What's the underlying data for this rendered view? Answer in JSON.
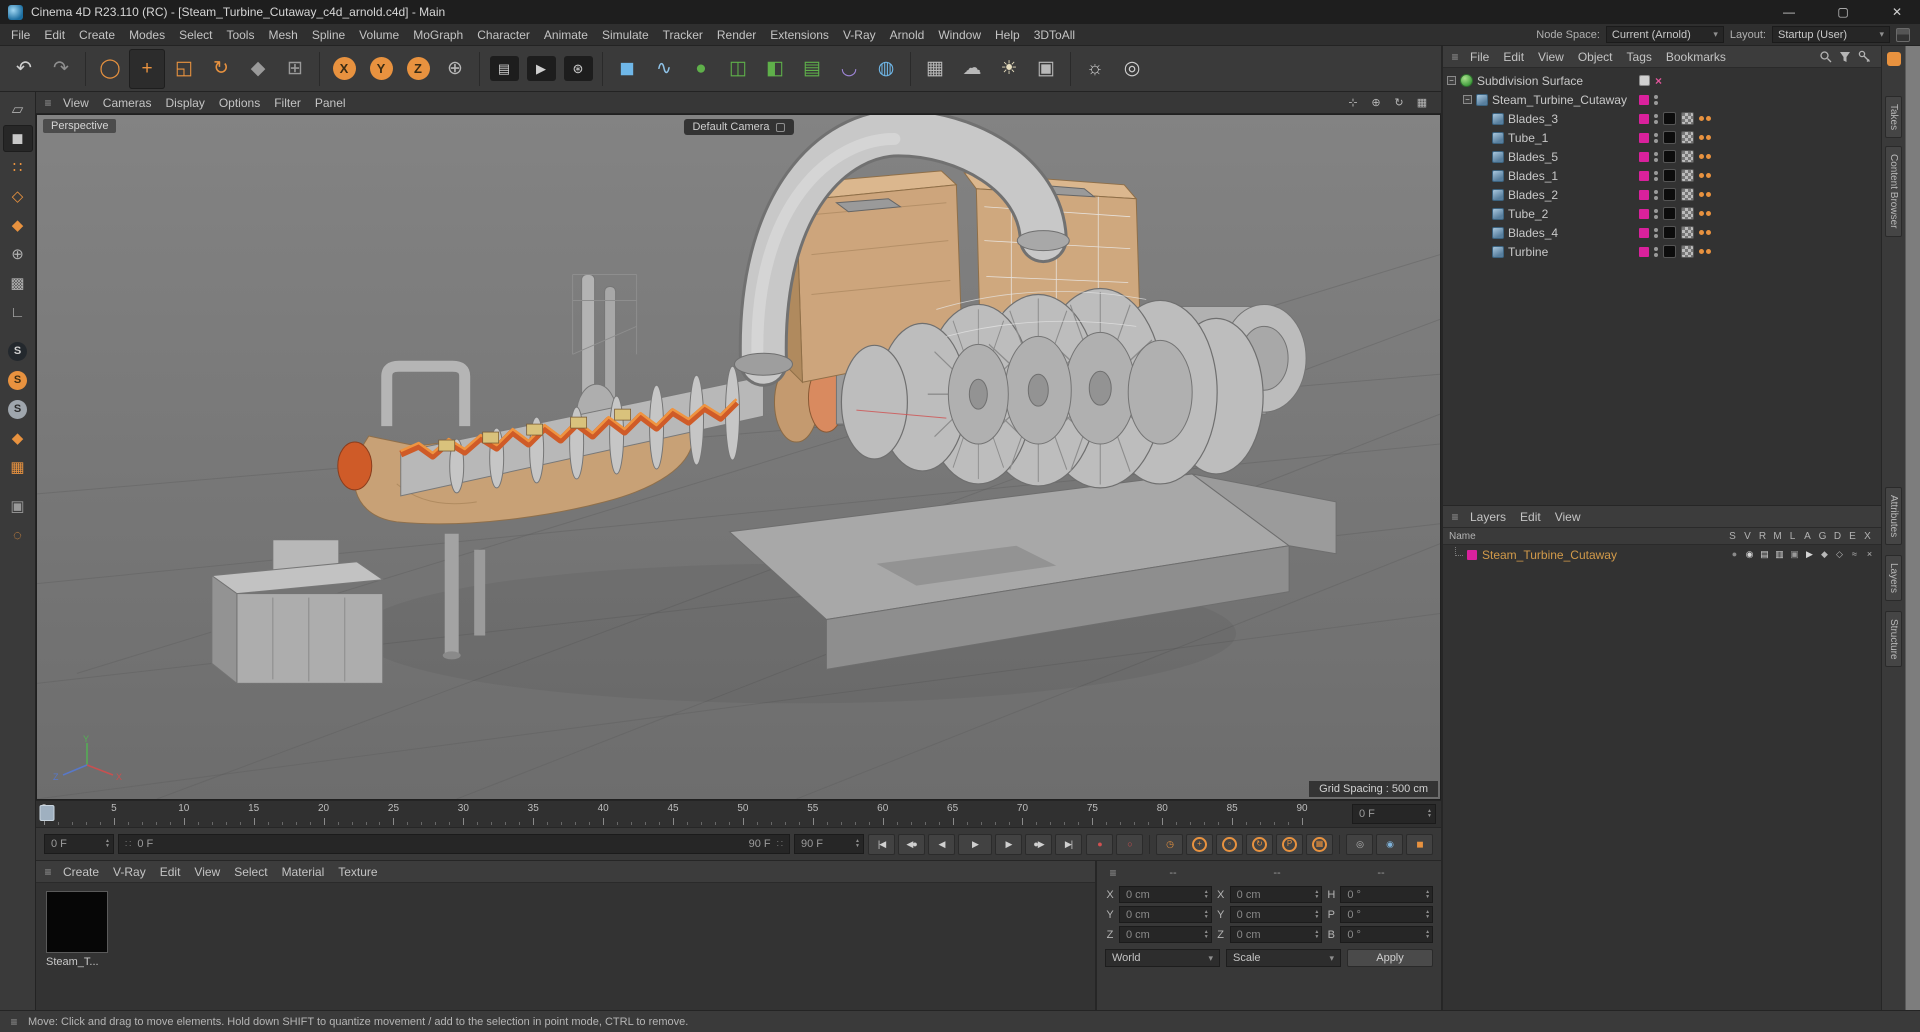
{
  "window": {
    "title": "Cinema 4D R23.110 (RC) - [Steam_Turbine_Cutaway_c4d_arnold.c4d] - Main",
    "minimize_glyph": "—",
    "maximize_glyph": "▢",
    "close_glyph": "✕"
  },
  "icons": {
    "hamburger": "≡",
    "dropdown_arrow": "▾",
    "spinner_up": "▲",
    "spinner_down": "▼",
    "slider_grip": "∷",
    "expander_open": "−"
  },
  "menubar": {
    "items": [
      "File",
      "Edit",
      "Create",
      "Modes",
      "Select",
      "Tools",
      "Mesh",
      "Spline",
      "Volume",
      "MoGraph",
      "Character",
      "Animate",
      "Simulate",
      "Tracker",
      "Render",
      "Extensions",
      "V-Ray",
      "Arnold",
      "Window",
      "Help",
      "3DToAll"
    ],
    "node_space_label": "Node Space:",
    "node_space_value": "Current (Arnold)",
    "layout_label": "Layout:",
    "layout_value": "Startup (User)"
  },
  "toolbar": {
    "buttons": [
      {
        "name": "undo-button",
        "glyph": "↶",
        "color": "#cfcfcf"
      },
      {
        "name": "redo-button",
        "glyph": "↷",
        "color": "#8f8f8f"
      },
      {
        "sep": true
      },
      {
        "name": "live-selection-tool",
        "glyph": "◯",
        "color": "#e8923f"
      },
      {
        "name": "move-tool",
        "glyph": "+",
        "color": "#e8923f",
        "selected": true
      },
      {
        "name": "scale-tool",
        "glyph": "◱",
        "color": "#e8923f"
      },
      {
        "name": "rotate-tool",
        "glyph": "↻",
        "color": "#e8923f"
      },
      {
        "name": "recent-tools-button",
        "glyph": "◆",
        "color": "#9a9a9a"
      },
      {
        "name": "omni-move-button",
        "glyph": "⊞",
        "color": "#9a9a9a"
      },
      {
        "sep": true
      },
      {
        "name": "x-axis-lock-button",
        "glyph": "X",
        "color": "#3a2c14",
        "bg": "#e8923f",
        "round": true
      },
      {
        "name": "y-axis-lock-button",
        "glyph": "Y",
        "color": "#3a2c14",
        "bg": "#e8923f",
        "round": true
      },
      {
        "name": "z-axis-lock-button",
        "glyph": "Z",
        "color": "#3a2c14",
        "bg": "#e8923f",
        "round": true
      },
      {
        "name": "coordinate-system-button",
        "glyph": "⊕",
        "color": "#b8b8b8"
      },
      {
        "sep": true
      },
      {
        "name": "render-view-button",
        "glyph": "▤",
        "color": "#cfcfcf",
        "bg": "#1d1d1d",
        "sq": true
      },
      {
        "name": "render-picture-viewer-button",
        "glyph": "▶",
        "color": "#cfcfcf",
        "bg": "#1d1d1d",
        "sq": true
      },
      {
        "name": "render-settings-button",
        "glyph": "⊛",
        "color": "#cfcfcf",
        "bg": "#1d1d1d",
        "sq": true
      },
      {
        "sep": true
      },
      {
        "name": "add-cube-button",
        "glyph": "◼",
        "color": "#6fb7e8"
      },
      {
        "name": "pen-tool-button",
        "glyph": "∿",
        "color": "#8fc3e8"
      },
      {
        "name": "subdivision-surface-button",
        "glyph": "●",
        "color": "#5fb04a"
      },
      {
        "name": "array-button",
        "glyph": "◫",
        "color": "#5fb04a"
      },
      {
        "name": "boolean-button",
        "glyph": "◧",
        "color": "#5fb04a"
      },
      {
        "name": "fields-button",
        "glyph": "▤",
        "color": "#5fb04a"
      },
      {
        "name": "deformer-button",
        "glyph": "◡",
        "color": "#9f86d8"
      },
      {
        "name": "volume-button",
        "glyph": "◍",
        "color": "#6fb7e8"
      },
      {
        "sep": true
      },
      {
        "name": "floor-button",
        "glyph": "▦",
        "color": "#b8b8b8"
      },
      {
        "name": "sky-button",
        "glyph": "☁",
        "color": "#b8b8b8"
      },
      {
        "name": "light-button",
        "glyph": "☀",
        "color": "#e8dfc0"
      },
      {
        "name": "camera-button",
        "glyph": "▣",
        "color": "#b8b8b8"
      },
      {
        "sep": true
      },
      {
        "name": "physical-sky-button",
        "glyph": "☼",
        "color": "#cfcfcf"
      },
      {
        "name": "environment-button",
        "glyph": "◎",
        "color": "#cfcfcf"
      }
    ]
  },
  "palette": {
    "buttons": [
      {
        "name": "make-editable-button",
        "glyph": "▱",
        "color": "#b0b0b0"
      },
      {
        "name": "model-mode-button",
        "glyph": "◼",
        "color": "#c8c8c8",
        "selected": true
      },
      {
        "name": "points-mode-button",
        "glyph": "∷",
        "color": "#e8923f"
      },
      {
        "name": "edges-mode-button",
        "glyph": "◇",
        "color": "#e8923f"
      },
      {
        "name": "polygons-mode-button",
        "glyph": "◆",
        "color": "#e8923f"
      },
      {
        "name": "axis-mode-button",
        "glyph": "⊕",
        "color": "#b0b0b0"
      },
      {
        "name": "texture-mode-button",
        "glyph": "▩",
        "color": "#b0b0b0"
      },
      {
        "name": "workplane-mode-button",
        "glyph": "∟",
        "color": "#b0b0b0"
      },
      {
        "sep": true
      },
      {
        "name": "snap-off-button",
        "glyph": "S",
        "color": "#cfcfcf",
        "bg": "#23282d",
        "round": true
      },
      {
        "name": "snap-on-button",
        "glyph": "S",
        "color": "#3a2c14",
        "bg": "#e8923f",
        "round": true
      },
      {
        "name": "snap-settings-button",
        "glyph": "S",
        "color": "#2c2c2c",
        "bg": "#9fa6ad",
        "round": true
      },
      {
        "name": "quantize-button",
        "glyph": "◆",
        "color": "#e8923f"
      },
      {
        "name": "grid-snap-button",
        "glyph": "▦",
        "color": "#e8923f"
      },
      {
        "sep": true
      },
      {
        "name": "workplane-lock-button",
        "glyph": "▣",
        "color": "#9a9a9a"
      },
      {
        "name": "dynamic-guides-button",
        "glyph": "◌",
        "color": "#e8923f"
      }
    ]
  },
  "viewport": {
    "menus": [
      "View",
      "Cameras",
      "Display",
      "Options",
      "Filter",
      "Panel"
    ],
    "nav_icons": [
      {
        "name": "pan-view-icon",
        "glyph": "⊹"
      },
      {
        "name": "zoom-view-icon",
        "glyph": "⊕"
      },
      {
        "name": "rotate-view-icon",
        "glyph": "↻"
      },
      {
        "name": "toggle-view-icon",
        "glyph": "▦"
      }
    ],
    "projection_label": "Perspective",
    "camera_label": "Default Camera",
    "grid_spacing_label": "Grid Spacing : 500 cm",
    "axis": {
      "x": "X",
      "y": "Y",
      "z": "Z"
    }
  },
  "object_manager": {
    "menus": [
      "File",
      "Edit",
      "View",
      "Object",
      "Tags",
      "Bookmarks"
    ],
    "tree": [
      {
        "label": "Subdivision Surface",
        "level": 0,
        "icon": "subdivision",
        "expander": true,
        "toggle": true,
        "redx": true
      },
      {
        "label": "Steam_Turbine_Cutaway",
        "level": 1,
        "icon": "object",
        "expander": true,
        "layer": "#d9219c",
        "dots": true
      },
      {
        "label": "Blades_3",
        "level": 2,
        "icon": "object",
        "layer": "#d9219c",
        "dots": true,
        "tags": true
      },
      {
        "label": "Tube_1",
        "level": 2,
        "icon": "object",
        "layer": "#d9219c",
        "dots": true,
        "tags": true
      },
      {
        "label": "Blades_5",
        "level": 2,
        "icon": "object",
        "layer": "#d9219c",
        "dots": true,
        "tags": true
      },
      {
        "label": "Blades_1",
        "level": 2,
        "icon": "object",
        "layer": "#d9219c",
        "dots": true,
        "tags": true
      },
      {
        "label": "Blades_2",
        "level": 2,
        "icon": "object",
        "layer": "#d9219c",
        "dots": true,
        "tags": true
      },
      {
        "label": "Tube_2",
        "level": 2,
        "icon": "object",
        "layer": "#d9219c",
        "dots": true,
        "tags": true
      },
      {
        "label": "Blades_4",
        "level": 2,
        "icon": "object",
        "layer": "#d9219c",
        "dots": true,
        "tags": true
      },
      {
        "label": "Turbine",
        "level": 2,
        "icon": "object",
        "layer": "#d9219c",
        "dots": true,
        "tags": true
      }
    ]
  },
  "layers_panel": {
    "menus": [
      "Layers",
      "Edit",
      "View"
    ],
    "name_header": "Name",
    "columns": [
      "S",
      "V",
      "R",
      "M",
      "L",
      "A",
      "G",
      "D",
      "E",
      "X"
    ],
    "layer": {
      "label": "Steam_Turbine_Cutaway",
      "color": "#d9219c",
      "icons": [
        {
          "col": "S",
          "glyph": "●",
          "color": "#8a8a8a"
        },
        {
          "col": "V",
          "glyph": "◉",
          "color": "#d6d6d6"
        },
        {
          "col": "R",
          "glyph": "▤",
          "color": "#d6d6d6"
        },
        {
          "col": "M",
          "glyph": "▥",
          "color": "#d6d6d6"
        },
        {
          "col": "L",
          "glyph": "▣",
          "color": "#9a9a9a"
        },
        {
          "col": "A",
          "glyph": "▶",
          "color": "#d6d6d6"
        },
        {
          "col": "G",
          "glyph": "◆",
          "color": "#b8b8b8"
        },
        {
          "col": "D",
          "glyph": "◇",
          "color": "#b8b8b8"
        },
        {
          "col": "E",
          "glyph": "≈",
          "color": "#b8b8b8"
        },
        {
          "col": "X",
          "glyph": "×",
          "color": "#b8b8b8"
        }
      ]
    }
  },
  "right_tabs": [
    {
      "label": "Takes",
      "gap": 30
    },
    {
      "label": "Content Browser",
      "gap": 8
    },
    {
      "label": "Attributes",
      "gap": 250
    },
    {
      "label": "Layers",
      "gap": 10
    },
    {
      "label": "Structure",
      "gap": 10
    }
  ],
  "timeline": {
    "ticks": [
      0,
      5,
      10,
      15,
      20,
      25,
      30,
      35,
      40,
      45,
      50,
      55,
      60,
      65,
      70,
      75,
      80,
      85,
      90
    ],
    "max_frame": 90,
    "ruler_field_value": "0 F"
  },
  "transport": {
    "current_frame_value": "0 F",
    "slider_start_label": "0 F",
    "slider_end_label": "90 F",
    "end_frame_value": "90 F",
    "buttons": [
      {
        "name": "goto-start-button",
        "glyph": "|◀"
      },
      {
        "name": "prev-key-button",
        "glyph": "◀●"
      },
      {
        "name": "prev-frame-button",
        "glyph": "◀"
      },
      {
        "name": "play-button",
        "glyph": "▶",
        "wide": true
      },
      {
        "name": "next-frame-button",
        "glyph": "▶"
      },
      {
        "name": "next-key-button",
        "glyph": "●▶"
      },
      {
        "name": "goto-end-button",
        "glyph": "▶|"
      }
    ],
    "key_buttons": [
      {
        "name": "record-keyframe-button",
        "glyph": "●",
        "color": "#d05050"
      },
      {
        "name": "autokeying-button",
        "glyph": "○",
        "color": "#d05050"
      },
      {
        "sep": true
      },
      {
        "name": "keyframe-time-button",
        "glyph": "◷",
        "color": "#e8923f"
      },
      {
        "name": "key-position-button",
        "glyph": "+",
        "color": "#e8923f",
        "circ": true
      },
      {
        "name": "key-scale-button",
        "glyph": "▫",
        "color": "#e8923f",
        "circ": true
      },
      {
        "name": "key-rotation-button",
        "glyph": "↻",
        "color": "#e8923f",
        "circ": true
      },
      {
        "name": "key-parameter-button",
        "glyph": "P",
        "color": "#e8923f",
        "circ": true
      },
      {
        "name": "key-pla-button",
        "glyph": "▦",
        "color": "#e8923f",
        "circ": true
      },
      {
        "sep": true
      },
      {
        "name": "solo-animation-button",
        "glyph": "◎",
        "color": "#b8b8b8"
      },
      {
        "name": "motion-preview-button",
        "glyph": "◉",
        "color": "#7fb2d9"
      },
      {
        "name": "keyframe-cube-button",
        "glyph": "◼",
        "color": "#e8923f"
      }
    ]
  },
  "material_manager": {
    "menus": [
      "Create",
      "V-Ray",
      "Edit",
      "View",
      "Select",
      "Material",
      "Texture"
    ],
    "materials": [
      {
        "label": "Steam_T...",
        "color": "#060606"
      }
    ]
  },
  "coordinates": {
    "header_dashes": [
      "--",
      "--",
      "--"
    ],
    "rows": [
      {
        "cells": [
          {
            "label": "X",
            "value": "0 cm"
          },
          {
            "label": "X",
            "value": "0 cm"
          },
          {
            "label": "H",
            "value": "0 °"
          }
        ]
      },
      {
        "cells": [
          {
            "label": "Y",
            "value": "0 cm"
          },
          {
            "label": "Y",
            "value": "0 cm"
          },
          {
            "label": "P",
            "value": "0 °"
          }
        ]
      },
      {
        "cells": [
          {
            "label": "Z",
            "value": "0 cm"
          },
          {
            "label": "Z",
            "value": "0 cm"
          },
          {
            "label": "B",
            "value": "0 °"
          }
        ]
      }
    ],
    "dropdown_left": "World",
    "dropdown_right": "Scale",
    "apply_label": "Apply"
  },
  "statusbar": {
    "text": "Move: Click and drag to move elements. Hold down SHIFT to quantize movement / add to the selection in point mode, CTRL to remove."
  }
}
